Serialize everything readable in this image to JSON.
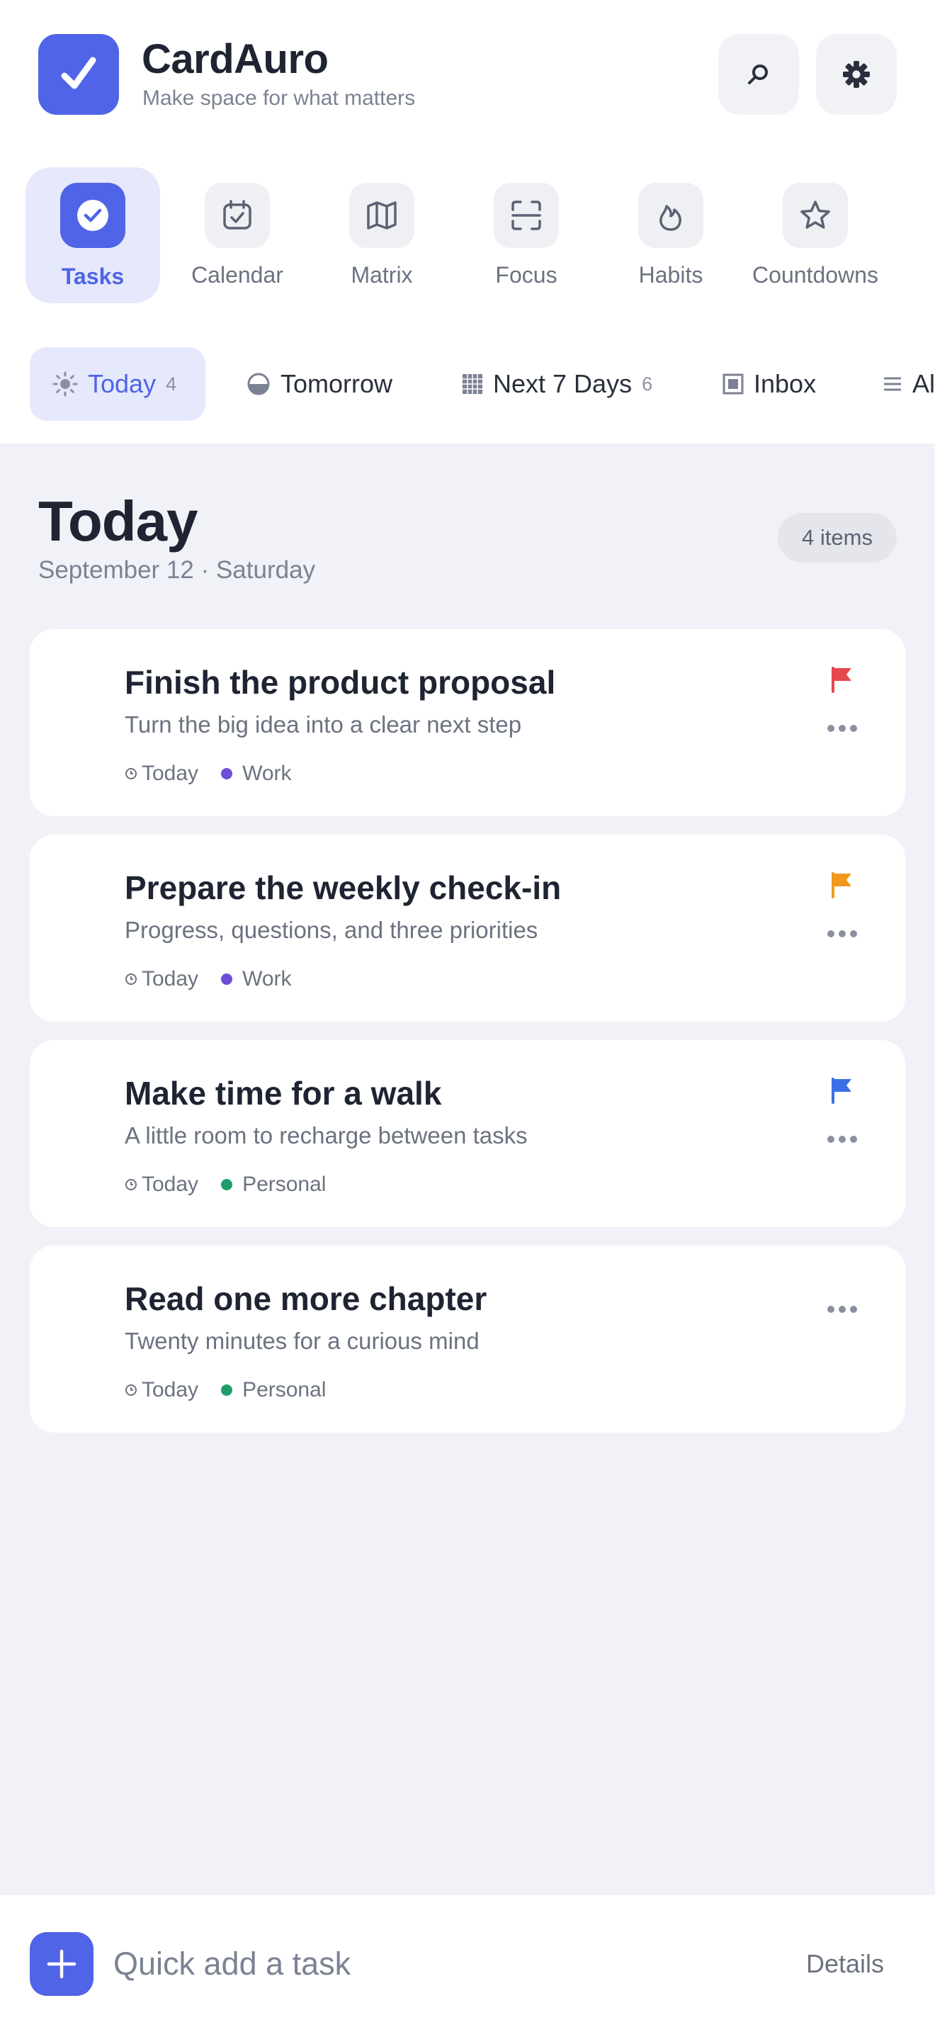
{
  "app": {
    "title": "CardAuro",
    "subtitle": "Make space for what matters",
    "accent_color": "#4f64e6"
  },
  "header_actions": [
    {
      "name": "search",
      "icon": "search-icon"
    },
    {
      "name": "settings",
      "icon": "gear-icon"
    }
  ],
  "modules": [
    {
      "label": "Tasks",
      "icon": "check-circle-icon",
      "active": true
    },
    {
      "label": "Calendar",
      "icon": "calendar-check-icon",
      "active": false
    },
    {
      "label": "Matrix",
      "icon": "map-icon",
      "active": false
    },
    {
      "label": "Focus",
      "icon": "scan-frame-icon",
      "active": false
    },
    {
      "label": "Habits",
      "icon": "flame-icon",
      "active": false
    },
    {
      "label": "Countdowns",
      "icon": "star-icon",
      "active": false
    }
  ],
  "filters": [
    {
      "label": "Today",
      "icon": "sun-icon",
      "count": "4",
      "active": true
    },
    {
      "label": "Tomorrow",
      "icon": "half-circle-icon",
      "count": "",
      "active": false
    },
    {
      "label": "Next 7 Days",
      "icon": "grid-calendar-icon",
      "count": "6",
      "active": false
    },
    {
      "label": "Inbox",
      "icon": "inbox-square-icon",
      "count": "",
      "active": false
    },
    {
      "label": "All",
      "icon": "list-icon",
      "count": "",
      "active": false
    }
  ],
  "list": {
    "title": "Today",
    "date": "September 12 · Saturday",
    "count_label": "4 items"
  },
  "tasks": [
    {
      "title": "Finish the product proposal",
      "subtitle": "Turn the big idea into a clear next step",
      "due": "Today",
      "tag": "Work",
      "tag_color": "#6d4fd8",
      "flag_color": "#e5484d"
    },
    {
      "title": "Prepare the weekly check-in",
      "subtitle": "Progress, questions, and three priorities",
      "due": "Today",
      "tag": "Work",
      "tag_color": "#6d4fd8",
      "flag_color": "#f2991d"
    },
    {
      "title": "Make time for a walk",
      "subtitle": "A little room to recharge between tasks",
      "due": "Today",
      "tag": "Personal",
      "tag_color": "#1f9d6b",
      "flag_color": "#3b6fe8"
    },
    {
      "title": "Read one more chapter",
      "subtitle": "Twenty minutes for a curious mind",
      "due": "Today",
      "tag": "Personal",
      "tag_color": "#1f9d6b",
      "flag_color": ""
    }
  ],
  "quick_add": {
    "placeholder": "Quick add a task",
    "details_label": "Details"
  }
}
